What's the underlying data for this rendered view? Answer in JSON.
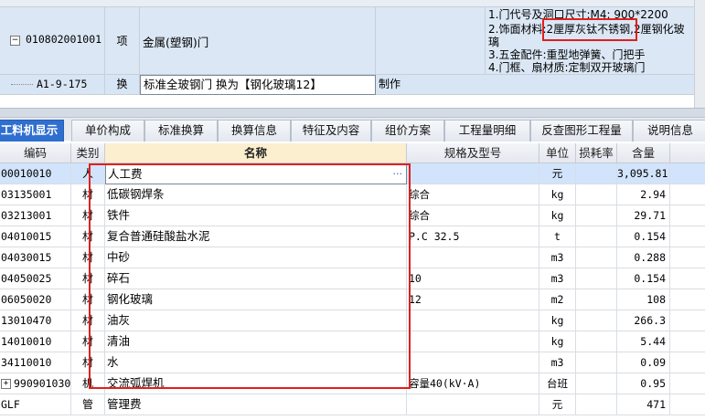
{
  "upper_grid": {
    "row_main": {
      "toggle": "−",
      "code": "010802001001",
      "type": "项",
      "name": "金属(塑钢)门",
      "features": [
        "1.门代号及洞口尺寸:M4: 900*2200",
        "2.饰面材料:",
        "2厘厚灰钛不锈钢",
        ",2厘钢化玻",
        "璃",
        "3.五金配件:重型地弹簧、门把手",
        "4.门框、扇材质:定制双开玻璃门"
      ]
    },
    "row_sub": {
      "code": "A1-9-175",
      "type": "换",
      "name": "标准全玻钢门  换为【钢化玻璃12】",
      "feature": "制作"
    }
  },
  "tabs": [
    {
      "label": "工料机显示",
      "active": true
    },
    {
      "label": "单价构成"
    },
    {
      "label": "标准换算"
    },
    {
      "label": "换算信息"
    },
    {
      "label": "特征及内容"
    },
    {
      "label": "组价方案"
    },
    {
      "label": "工程量明细"
    },
    {
      "label": "反查图形工程量"
    },
    {
      "label": "说明信息"
    }
  ],
  "columns": {
    "code": "编码",
    "type": "类别",
    "name": "名称",
    "spec": "规格及型号",
    "unit": "单位",
    "loss": "损耗率",
    "qty": "含量"
  },
  "rows": [
    {
      "code": "00010010",
      "type": "人",
      "name": "人工费",
      "spec": "",
      "unit": "元",
      "qty": "3,095.81",
      "selected": true
    },
    {
      "code": "03135001",
      "type": "材",
      "name": "低碳钢焊条",
      "spec": "综合",
      "unit": "kg",
      "qty": "2.94"
    },
    {
      "code": "03213001",
      "type": "材",
      "name": "铁件",
      "spec": "综合",
      "unit": "kg",
      "qty": "29.71"
    },
    {
      "code": "04010015",
      "type": "材",
      "name": "复合普通硅酸盐水泥",
      "spec": "P.C 32.5",
      "unit": "t",
      "qty": "0.154"
    },
    {
      "code": "04030015",
      "type": "材",
      "name": "中砂",
      "spec": "",
      "unit": "m3",
      "qty": "0.288"
    },
    {
      "code": "04050025",
      "type": "材",
      "name": "碎石",
      "spec": "10",
      "unit": "m3",
      "qty": "0.154"
    },
    {
      "code": "06050020",
      "type": "材",
      "name": "钢化玻璃",
      "spec": "12",
      "unit": "m2",
      "qty": "108"
    },
    {
      "code": "13010470",
      "type": "材",
      "name": "油灰",
      "spec": "",
      "unit": "kg",
      "qty": "266.3"
    },
    {
      "code": "14010010",
      "type": "材",
      "name": "清油",
      "spec": "",
      "unit": "kg",
      "qty": "5.44"
    },
    {
      "code": "34110010",
      "type": "材",
      "name": "水",
      "spec": "",
      "unit": "m3",
      "qty": "0.09"
    },
    {
      "code": "990901030",
      "type": "机",
      "name": "交流弧焊机",
      "spec": "容量40(kV·A)",
      "unit": "台班",
      "qty": "0.95",
      "expandable": true,
      "toggle": "+"
    },
    {
      "code": "GLF",
      "type": "管",
      "name": "管理费",
      "spec": "",
      "unit": "元",
      "qty": "471"
    }
  ],
  "ellipsis": "···",
  "colors": {
    "highlight": "#e0201c",
    "tab_active": "#2f6fd0",
    "row_selected": "#d2e4fb"
  }
}
